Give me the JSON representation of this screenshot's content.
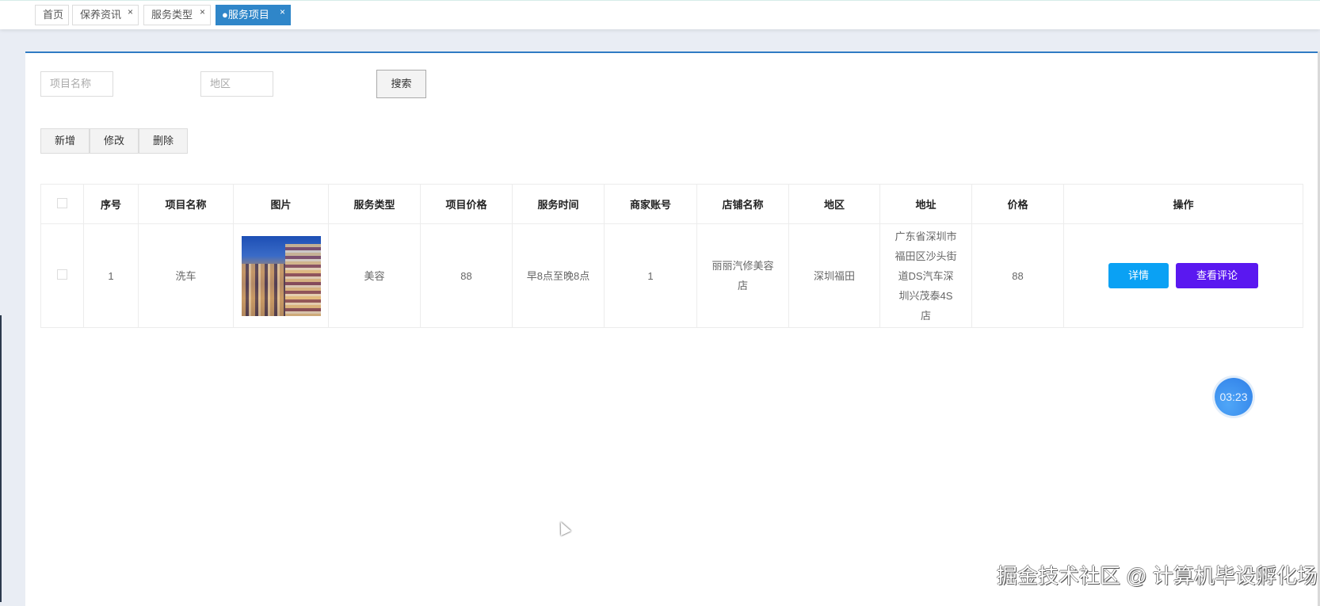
{
  "tabs": [
    {
      "label": "首页",
      "closable": false
    },
    {
      "label": "保养资讯",
      "closable": true
    },
    {
      "label": "服务类型",
      "closable": true
    },
    {
      "label": "●服务项目",
      "closable": true,
      "active": true
    }
  ],
  "close_glyph": "×",
  "search": {
    "name_placeholder": "项目名称",
    "region_placeholder": "地区",
    "button": "搜索"
  },
  "actions": {
    "add": "新增",
    "edit": "修改",
    "delete": "删除"
  },
  "table": {
    "headers": [
      "序号",
      "项目名称",
      "图片",
      "服务类型",
      "项目价格",
      "服务时间",
      "商家账号",
      "店铺名称",
      "地区",
      "地址",
      "价格",
      "操作"
    ],
    "rows": [
      {
        "index": "1",
        "name": "洗车",
        "type": "美容",
        "item_price": "88",
        "time": "早8点至晚8点",
        "merchant": "1",
        "shop": "丽丽汽修美容店",
        "region": "深圳福田",
        "address": "广东省深圳市福田区沙头街道DS汽车深圳兴茂泰4S店",
        "price": "88",
        "detail": "详情",
        "comments": "查看评论"
      }
    ]
  },
  "timer": "03:23",
  "watermark": "掘金技术社区 @ 计算机毕设孵化场",
  "colors": {
    "accent": "#2f86c9",
    "detail": "#0aa1f4",
    "comment": "#5a18f0"
  }
}
